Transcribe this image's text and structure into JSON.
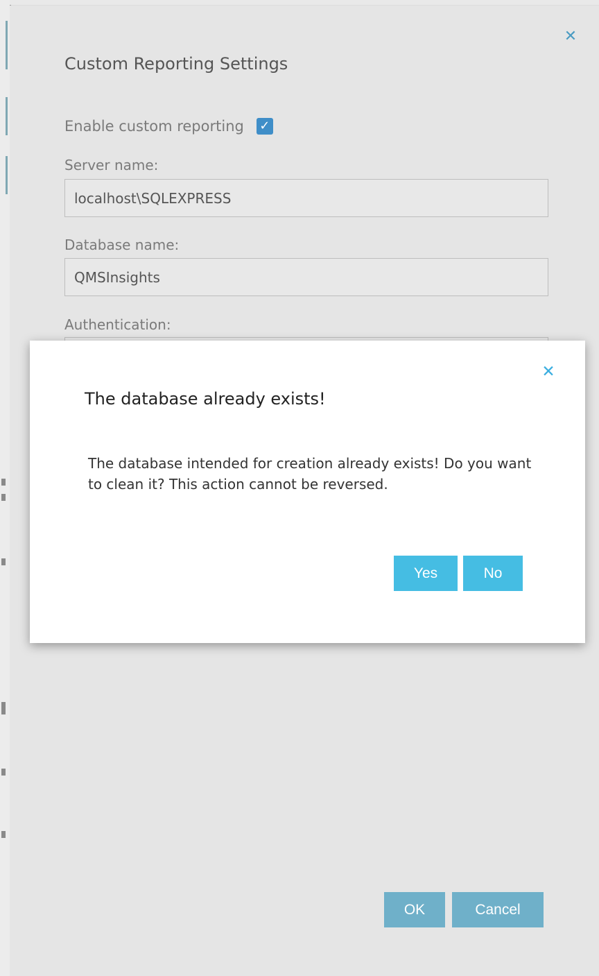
{
  "settings": {
    "title": "Custom Reporting Settings",
    "close_icon": "close-icon",
    "enable_label": "Enable custom reporting",
    "enable_checked": true,
    "server_label": "Server name:",
    "server_value": "localhost\\SQLEXPRESS",
    "database_label": "Database name:",
    "database_value": "QMSInsights",
    "auth_label": "Authentication:",
    "ok_label": "OK",
    "cancel_label": "Cancel"
  },
  "modal": {
    "title": "The database already exists!",
    "close_icon": "close-icon",
    "message": "The database intended for creation already exists! Do you want to clean it? This action cannot be reversed.",
    "yes_label": "Yes",
    "no_label": "No"
  },
  "colors": {
    "accent": "#45bde3",
    "accent_dim": "#6fb0c9",
    "checkbox": "#3f8ec8"
  }
}
